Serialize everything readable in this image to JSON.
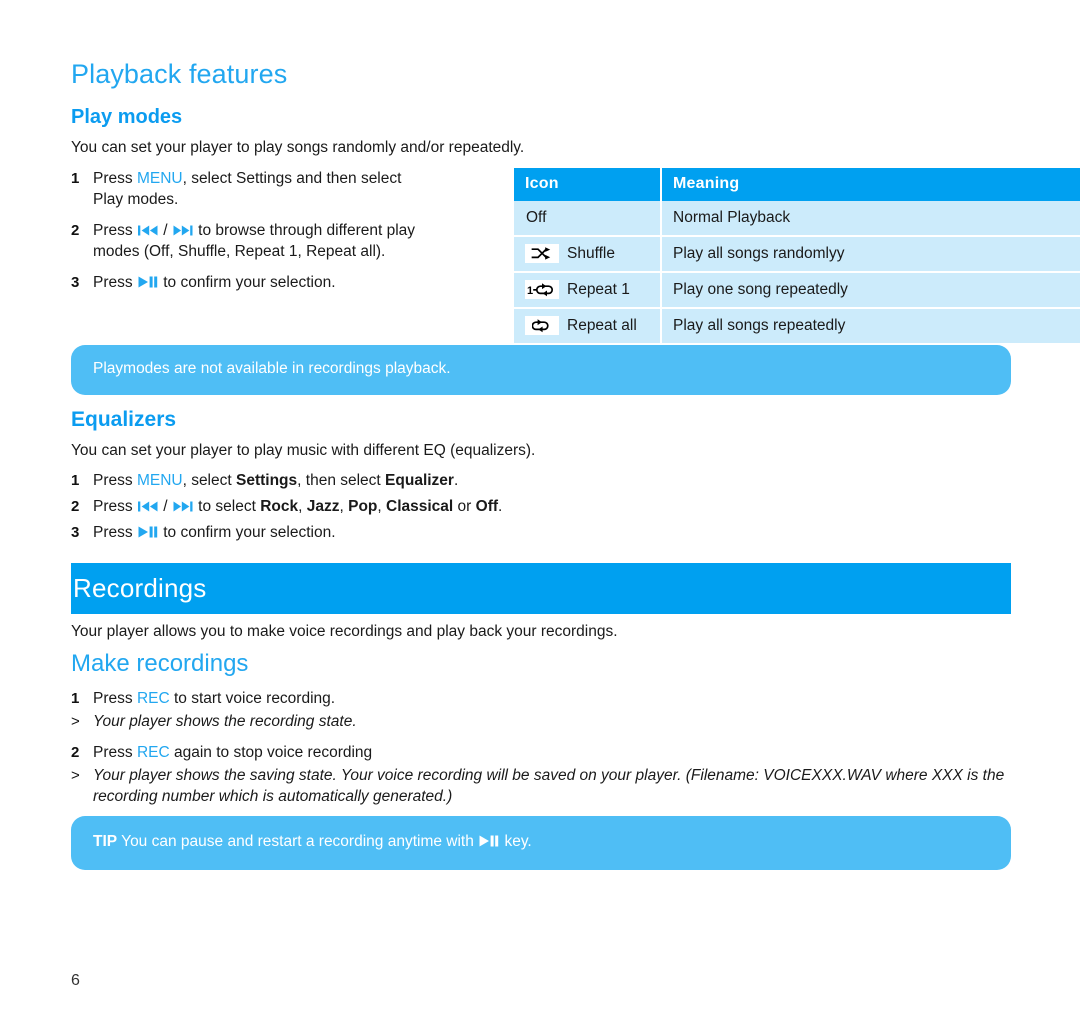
{
  "page": {
    "number": "6"
  },
  "playback": {
    "title": "Playback features",
    "play_modes": {
      "heading": "Play modes",
      "intro": "You can set your player to play songs randomly and/or repeatedly.",
      "steps": [
        {
          "num": "1",
          "pre": "Press ",
          "key": "MENU",
          "post": ", select Settings and then select Play modes."
        },
        {
          "num": "2",
          "pre": "Press ",
          "icon_a": "skip-previous-icon",
          "sep": " / ",
          "icon_b": "skip-next-icon",
          "post": " to browse through different play modes (Off, Shuffle, Repeat 1, Repeat all)."
        },
        {
          "num": "3",
          "pre": "Press ",
          "icon_a": "play-pause-icon",
          "post": " to confirm your selection."
        }
      ],
      "table": {
        "headers": [
          "Icon",
          "Meaning"
        ],
        "rows": [
          {
            "icon": "",
            "icon_name": "",
            "label": "Off",
            "meaning": "Normal Playback"
          },
          {
            "icon": "shuffle-icon",
            "icon_name": "shuffle-icon",
            "label": "Shuffle",
            "meaning": "Play all songs randomlyy"
          },
          {
            "icon": "repeat-one-icon",
            "icon_name": "repeat-one-icon",
            "label": "Repeat 1",
            "meaning": "Play one song repeatedly"
          },
          {
            "icon": "repeat-all-icon",
            "icon_name": "repeat-all-icon",
            "label": "Repeat all",
            "meaning": "Play all songs repeatedly"
          }
        ]
      },
      "note": "Playmodes are not available in recordings playback."
    },
    "equalizers": {
      "heading": "Equalizers",
      "intro": "You can set your player to play music with different EQ (equalizers).",
      "steps": [
        {
          "num": "1",
          "pre": "Press ",
          "key": "MENU",
          "mid": ", select ",
          "bold_a": "Settings",
          "mid2": ", then select ",
          "bold_b": "Equalizer",
          "post": "."
        },
        {
          "num": "2",
          "pre": "Press ",
          "icon_a": "skip-previous-icon",
          "sep": " / ",
          "icon_b": "skip-next-icon",
          "mid": " to select ",
          "opt1": "Rock",
          "c1": ", ",
          "opt2": "Jazz",
          "c2": ", ",
          "opt3": "Pop",
          "c3": ", ",
          "opt4": "Classical",
          "c4": " or ",
          "opt5": "Off",
          "post": "."
        },
        {
          "num": "3",
          "pre": "Press ",
          "icon_a": "play-pause-icon",
          "post": " to confirm your selection."
        }
      ]
    }
  },
  "recordings": {
    "banner_title": "Recordings",
    "intro": "Your player allows you to make voice recordings and play back your recordings.",
    "make_recordings": {
      "heading": "Make recordings",
      "steps": [
        {
          "num": "1",
          "pre": "Press ",
          "key": "REC",
          "post": " to start voice recording."
        },
        {
          "num": "2",
          "pre": "Press ",
          "key": "REC",
          "post": " again to stop voice recording"
        }
      ],
      "results": [
        {
          "mark": ">",
          "text": "Your player shows the recording state."
        },
        {
          "mark": ">",
          "text": "Your player shows the saving state. Your voice recording will be saved on your player. (Filename: VOICEXXX.WAV where XXX is the recording number which is automatically generated.)"
        }
      ],
      "tip": {
        "label": "TIP",
        "pre": " You can pause and restart a recording anytime with ",
        "icon": "play-pause-icon",
        "post": " key."
      }
    }
  },
  "colors": {
    "accent_blue": "#22A7F0",
    "banner_blue": "#00A0F0",
    "callout_blue": "#4FBEF5",
    "table_row_blue": "#CCEBFB",
    "text": "#1a1a1a"
  }
}
